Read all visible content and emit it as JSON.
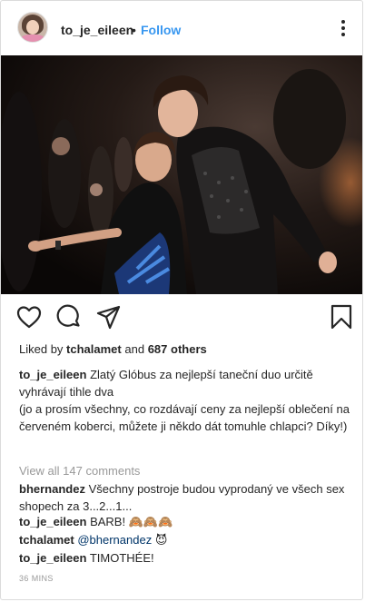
{
  "post": {
    "username": "to_je_eileen",
    "separator": "•",
    "follow_label": "Follow",
    "liked_by_prefix": "Liked by",
    "liked_by_user": "tchalamet",
    "liked_by_and": "and",
    "liked_by_others": "687 others",
    "caption_user": "to_je_eileen",
    "caption_line1": "Zlatý Glóbus za nejlepší taneční duo určitě vyhrávají tihle dva",
    "caption_line2": "(jo a prosím všechny, co rozdávají ceny za nejlepší oblečení na červeném koberci, můžete ji někdo dát tomuhle chlapci? Díky!)",
    "view_all_comments": "View all 147 comments",
    "timestamp": "36 MINS"
  },
  "comments": [
    {
      "user": "bhernandez",
      "text": "Všechny postroje budou vyprodaný ve všech sex shopech za 3...2...1..."
    },
    {
      "user": "to_je_eileen",
      "text": "BARB!",
      "emoji": "🙈🙈🙈"
    },
    {
      "user": "tchalamet",
      "mention": "@bhernandez",
      "emoji": "😈"
    },
    {
      "user": "to_je_eileen",
      "text": "TIMOTHÉE!"
    }
  ],
  "icons": {
    "like": "heart-icon",
    "comment": "comment-icon",
    "share": "share-icon",
    "save": "bookmark-icon",
    "more": "more-options-icon"
  },
  "colors": {
    "link_blue": "#3897f0",
    "muted_gray": "#999999",
    "text": "#262626"
  }
}
